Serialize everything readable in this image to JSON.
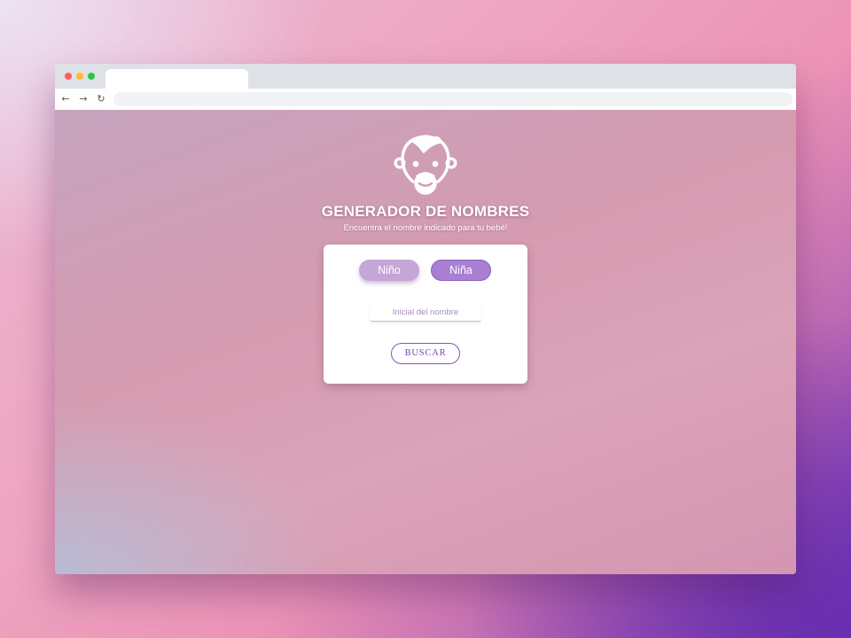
{
  "browser": {
    "nav": {
      "back_icon": "←",
      "forward_icon": "→",
      "reload_icon": "↻"
    },
    "address_bar": {
      "value": ""
    }
  },
  "page": {
    "logo_icon": "baby-face-icon",
    "title": "GENERADOR DE NOMBRES",
    "subtitle": "Encuentra el nombre indicado para tu bebé!",
    "gender_buttons": [
      {
        "label": "Niño",
        "selected": false
      },
      {
        "label": "Niña",
        "selected": true
      }
    ],
    "initial_input": {
      "placeholder": "Inicial del nombre",
      "value": ""
    },
    "search_button": "BUSCAR"
  },
  "colors": {
    "accent": "#8b54b8",
    "nino_button": "#c5a6d9",
    "nina_button": "#a97fd1"
  }
}
